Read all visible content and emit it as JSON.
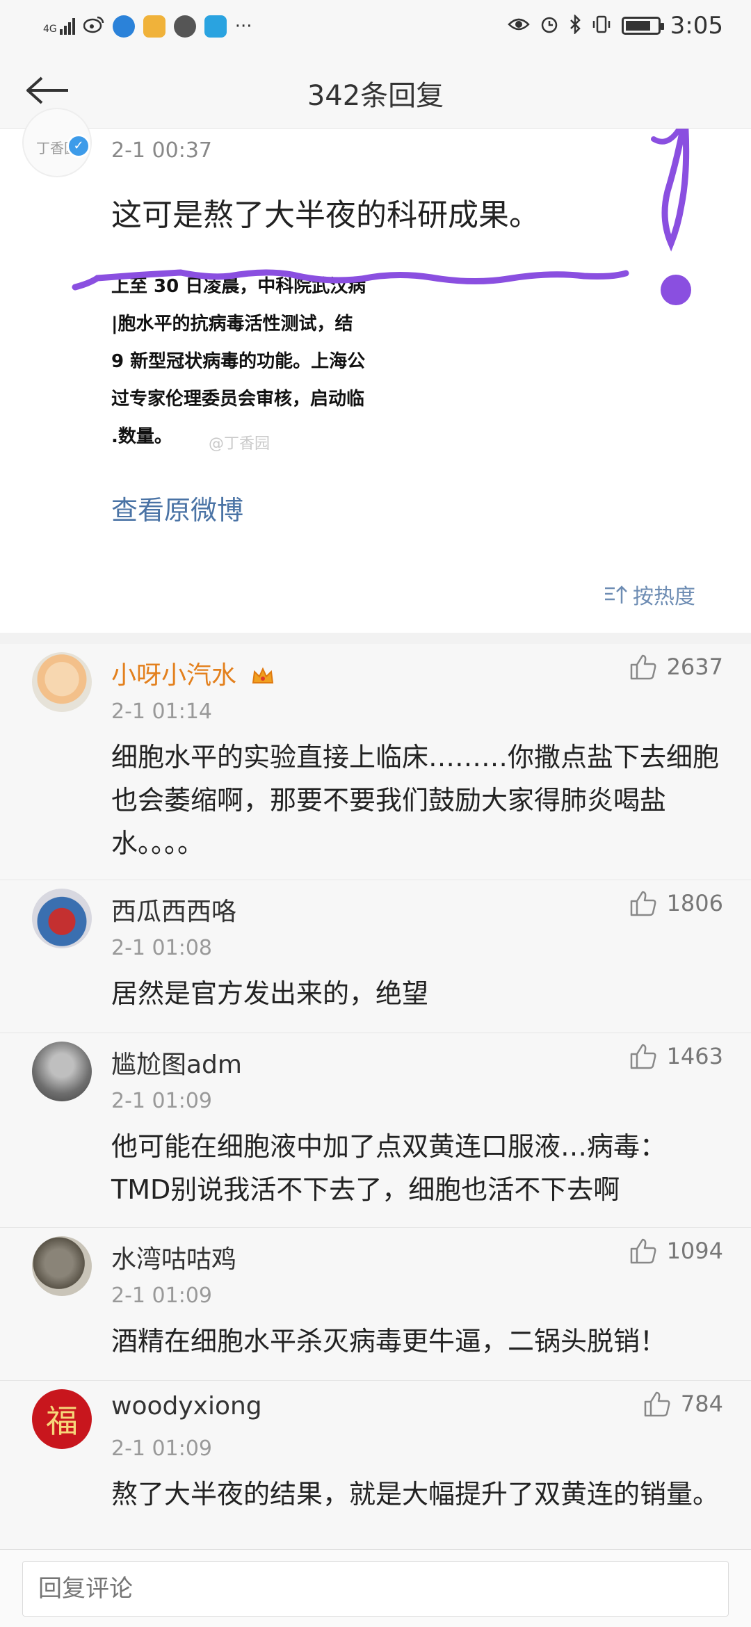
{
  "status_bar": {
    "network": "4G",
    "time": "3:05",
    "icons": [
      "signal-icon",
      "weibo-icon",
      "browser-icon",
      "app-icon",
      "chat-icon",
      "app2-icon",
      "more-icon",
      "eye-icon",
      "alarm-icon",
      "bluetooth-icon",
      "vibrate-icon",
      "battery-icon"
    ],
    "more": "···"
  },
  "nav": {
    "title": "342条回复",
    "back_icon": "back-arrow-icon"
  },
  "original_post": {
    "avatar_text": "丁香园",
    "time": "2-1 00:37",
    "text": "这可是熬了大半夜的科研成果。",
    "embedded_lines": [
      "上至 30 日凌晨，中科院武汉病",
      "|胞水平的抗病毒活性测试，结",
      "9 新型冠状病毒的功能。上海公",
      "过专家伦理委员会审核，启动临",
      ".数量。"
    ],
    "watermark": "@丁香园",
    "view_original": "查看原微博",
    "sort_label": "按热度"
  },
  "annotation": {
    "color": "#8a4fe0"
  },
  "comments": [
    {
      "name": "小呀小汽水",
      "vip": true,
      "time": "2-1 01:14",
      "likes": "2637",
      "text": "细胞水平的实验直接上临床………你撒点盐下去细胞也会萎缩啊，那要不要我们鼓励大家得肺炎喝盐水。。。。"
    },
    {
      "name": "西瓜西西咯",
      "vip": false,
      "time": "2-1 01:08",
      "likes": "1806",
      "text": "居然是官方发出来的，绝望"
    },
    {
      "name": "尴尬图adm",
      "vip": false,
      "time": "2-1 01:09",
      "likes": "1463",
      "text": "他可能在细胞液中加了点双黄连口服液…病毒：TMD别说我活不下去了，细胞也活不下去啊"
    },
    {
      "name": "水湾咕咕鸡",
      "vip": false,
      "time": "2-1 01:09",
      "likes": "1094",
      "text": "酒精在细胞水平杀灭病毒更牛逼，二锅头脱销！"
    },
    {
      "name": "woodyxiong",
      "vip": false,
      "time": "2-1 01:09",
      "likes": "784",
      "text": "熬了大半夜的结果，就是大幅提升了双黄连的销量。",
      "avatar_text": "福"
    }
  ],
  "reply_bar": {
    "placeholder": "回复评论"
  },
  "colors": {
    "link": "#4a73a5",
    "vip_name": "#e3801d",
    "verified": "#3d9be9"
  }
}
